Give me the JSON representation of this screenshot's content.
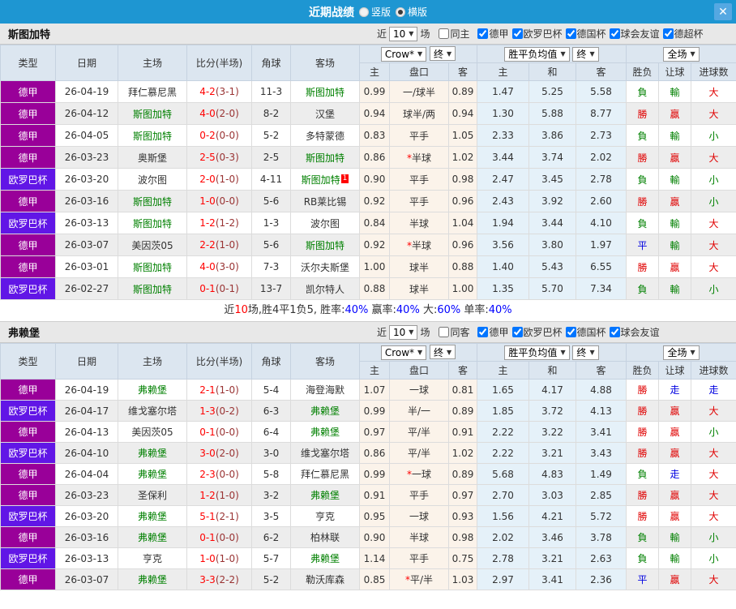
{
  "titlebar": {
    "title": "近期战绩",
    "layout_vertical": "竖版",
    "layout_horizontal": "横版",
    "close": "✕"
  },
  "table_columns": {
    "type": "类型",
    "date": "日期",
    "home": "主场",
    "score": "比分(半场)",
    "corner": "角球",
    "away": "客场",
    "odds_home": "主",
    "handicap": "盘口",
    "odds_away": "客",
    "avg_home": "主",
    "avg_draw": "和",
    "avg_away": "客",
    "result": "胜负",
    "handicap_result": "让球",
    "goals": "进球数"
  },
  "header_controls": {
    "odds_source": "Crow*",
    "final_1": "终",
    "avg_label": "胜平负均值",
    "final_2": "终",
    "scope": "全场"
  },
  "colors": {
    "titlebar": "#1e96d2",
    "close_btn": "#55a8e2",
    "badge_purple": "#990099",
    "badge_violet": "#6116e6",
    "win": "#e00000",
    "lose": "#008000",
    "draw": "#0000e0",
    "team_green": "#008000",
    "score_red": "#ff0000",
    "half_maroon": "#993333",
    "odds_col_bg": "#fbf3ea",
    "avg_col_bg": "#e5f1f9",
    "summary_red": "#ff0000",
    "summary_blue": "#0000ff"
  },
  "sections": [
    {
      "team": "斯图加特",
      "filter": {
        "near_label": "近",
        "count": "10",
        "games_label": "场",
        "same": {
          "label": "同主",
          "checked": false
        },
        "comps": [
          {
            "label": "德甲",
            "checked": true
          },
          {
            "label": "欧罗巴杯",
            "checked": true
          },
          {
            "label": "德国杯",
            "checked": true
          },
          {
            "label": "球会友谊",
            "checked": true
          },
          {
            "label": "德超杯",
            "checked": true
          }
        ]
      },
      "rows": [
        {
          "type": "德甲",
          "date": "26-04-19",
          "home": "拜仁慕尼黑",
          "home_active": false,
          "score": "4-2",
          "half": "(3-1)",
          "corner": "11-3",
          "away": "斯图加特",
          "away_active": true,
          "odds": [
            "0.99",
            "一/球半",
            "0.89"
          ],
          "avg": [
            "1.47",
            "5.25",
            "5.58"
          ],
          "results": [
            "負",
            "輸",
            "大"
          ]
        },
        {
          "type": "德甲",
          "date": "26-04-12",
          "home": "斯图加特",
          "home_active": true,
          "score": "4-0",
          "half": "(2-0)",
          "corner": "8-2",
          "away": "汉堡",
          "away_active": false,
          "odds": [
            "0.94",
            "球半/两",
            "0.94"
          ],
          "avg": [
            "1.30",
            "5.88",
            "8.77"
          ],
          "results": [
            "勝",
            "贏",
            "大"
          ]
        },
        {
          "type": "德甲",
          "date": "26-04-05",
          "home": "斯图加特",
          "home_active": true,
          "score": "0-2",
          "half": "(0-0)",
          "corner": "5-2",
          "away": "多特蒙德",
          "away_active": false,
          "odds": [
            "0.83",
            "平手",
            "1.05"
          ],
          "avg": [
            "2.33",
            "3.86",
            "2.73"
          ],
          "results": [
            "負",
            "輸",
            "小"
          ]
        },
        {
          "type": "德甲",
          "date": "26-03-23",
          "home": "奥斯堡",
          "home_active": false,
          "score": "2-5",
          "half": "(0-3)",
          "corner": "2-5",
          "away": "斯图加特",
          "away_active": true,
          "odds": [
            "0.86",
            "*半球",
            "1.02"
          ],
          "avg": [
            "3.44",
            "3.74",
            "2.02"
          ],
          "results": [
            "勝",
            "贏",
            "大"
          ]
        },
        {
          "type": "欧罗巴杯",
          "date": "26-03-20",
          "home": "波尔图",
          "home_active": false,
          "score": "2-0",
          "half": "(1-0)",
          "corner": "4-11",
          "away": "斯图加特",
          "away_active": true,
          "away_mark": "1",
          "odds": [
            "0.90",
            "平手",
            "0.98"
          ],
          "avg": [
            "2.47",
            "3.45",
            "2.78"
          ],
          "results": [
            "負",
            "輸",
            "小"
          ]
        },
        {
          "type": "德甲",
          "date": "26-03-16",
          "home": "斯图加特",
          "home_active": true,
          "score": "1-0",
          "half": "(0-0)",
          "corner": "5-6",
          "away": "RB莱比锡",
          "away_active": false,
          "odds": [
            "0.92",
            "平手",
            "0.96"
          ],
          "avg": [
            "2.43",
            "3.92",
            "2.60"
          ],
          "results": [
            "勝",
            "贏",
            "小"
          ]
        },
        {
          "type": "欧罗巴杯",
          "date": "26-03-13",
          "home": "斯图加特",
          "home_active": true,
          "score": "1-2",
          "half": "(1-2)",
          "corner": "1-3",
          "away": "波尔图",
          "away_active": false,
          "odds": [
            "0.84",
            "半球",
            "1.04"
          ],
          "avg": [
            "1.94",
            "3.44",
            "4.10"
          ],
          "results": [
            "負",
            "輸",
            "大"
          ]
        },
        {
          "type": "德甲",
          "date": "26-03-07",
          "home": "美因茨05",
          "home_active": false,
          "score": "2-2",
          "half": "(1-0)",
          "corner": "5-6",
          "away": "斯图加特",
          "away_active": true,
          "odds": [
            "0.92",
            "*半球",
            "0.96"
          ],
          "avg": [
            "3.56",
            "3.80",
            "1.97"
          ],
          "results": [
            "平",
            "輸",
            "大"
          ]
        },
        {
          "type": "德甲",
          "date": "26-03-01",
          "home": "斯图加特",
          "home_active": true,
          "score": "4-0",
          "half": "(3-0)",
          "corner": "7-3",
          "away": "沃尔夫斯堡",
          "away_active": false,
          "odds": [
            "1.00",
            "球半",
            "0.88"
          ],
          "avg": [
            "1.40",
            "5.43",
            "6.55"
          ],
          "results": [
            "勝",
            "贏",
            "大"
          ]
        },
        {
          "type": "欧罗巴杯",
          "date": "26-02-27",
          "home": "斯图加特",
          "home_active": true,
          "score": "0-1",
          "half": "(0-1)",
          "corner": "13-7",
          "away": "凯尔特人",
          "away_active": false,
          "odds": [
            "0.88",
            "球半",
            "1.00"
          ],
          "avg": [
            "1.35",
            "5.70",
            "7.34"
          ],
          "results": [
            "負",
            "輸",
            "小"
          ]
        }
      ],
      "summary": [
        {
          "text": "近",
          "color": "default"
        },
        {
          "text": "10",
          "color": "red"
        },
        {
          "text": "场,胜4平1负5, 胜率:",
          "color": "default"
        },
        {
          "text": "40%",
          "color": "blue"
        },
        {
          "text": " 赢率:",
          "color": "default"
        },
        {
          "text": "40%",
          "color": "blue"
        },
        {
          "text": " 大:",
          "color": "default"
        },
        {
          "text": "60%",
          "color": "blue"
        },
        {
          "text": " 单率:",
          "color": "default"
        },
        {
          "text": "40%",
          "color": "blue"
        }
      ]
    },
    {
      "team": "弗赖堡",
      "filter": {
        "near_label": "近",
        "count": "10",
        "games_label": "场",
        "same": {
          "label": "同客",
          "checked": false
        },
        "comps": [
          {
            "label": "德甲",
            "checked": true
          },
          {
            "label": "欧罗巴杯",
            "checked": true
          },
          {
            "label": "德国杯",
            "checked": true
          },
          {
            "label": "球会友谊",
            "checked": true
          }
        ]
      },
      "rows": [
        {
          "type": "德甲",
          "date": "26-04-19",
          "home": "弗赖堡",
          "home_active": true,
          "score": "2-1",
          "half": "(1-0)",
          "corner": "5-4",
          "away": "海登海默",
          "away_active": false,
          "odds": [
            "1.07",
            "一球",
            "0.81"
          ],
          "avg": [
            "1.65",
            "4.17",
            "4.88"
          ],
          "results": [
            "勝",
            "走",
            "走"
          ]
        },
        {
          "type": "欧罗巴杯",
          "date": "26-04-17",
          "home": "维戈塞尔塔",
          "home_active": false,
          "score": "1-3",
          "half": "(0-2)",
          "corner": "6-3",
          "away": "弗赖堡",
          "away_active": true,
          "odds": [
            "0.99",
            "半/一",
            "0.89"
          ],
          "avg": [
            "1.85",
            "3.72",
            "4.13"
          ],
          "results": [
            "勝",
            "贏",
            "大"
          ]
        },
        {
          "type": "德甲",
          "date": "26-04-13",
          "home": "美因茨05",
          "home_active": false,
          "score": "0-1",
          "half": "(0-0)",
          "corner": "6-4",
          "away": "弗赖堡",
          "away_active": true,
          "odds": [
            "0.97",
            "平/半",
            "0.91"
          ],
          "avg": [
            "2.22",
            "3.22",
            "3.41"
          ],
          "results": [
            "勝",
            "贏",
            "小"
          ]
        },
        {
          "type": "欧罗巴杯",
          "date": "26-04-10",
          "home": "弗赖堡",
          "home_active": true,
          "score": "3-0",
          "half": "(2-0)",
          "corner": "3-0",
          "away": "维戈塞尔塔",
          "away_active": false,
          "odds": [
            "0.86",
            "平/半",
            "1.02"
          ],
          "avg": [
            "2.22",
            "3.21",
            "3.43"
          ],
          "results": [
            "勝",
            "贏",
            "大"
          ]
        },
        {
          "type": "德甲",
          "date": "26-04-04",
          "home": "弗赖堡",
          "home_active": true,
          "score": "2-3",
          "half": "(0-0)",
          "corner": "5-8",
          "away": "拜仁慕尼黑",
          "away_active": false,
          "odds": [
            "0.99",
            "*一球",
            "0.89"
          ],
          "avg": [
            "5.68",
            "4.83",
            "1.49"
          ],
          "results": [
            "負",
            "走",
            "大"
          ]
        },
        {
          "type": "德甲",
          "date": "26-03-23",
          "home": "圣保利",
          "home_active": false,
          "score": "1-2",
          "half": "(1-0)",
          "corner": "3-2",
          "away": "弗赖堡",
          "away_active": true,
          "odds": [
            "0.91",
            "平手",
            "0.97"
          ],
          "avg": [
            "2.70",
            "3.03",
            "2.85"
          ],
          "results": [
            "勝",
            "贏",
            "大"
          ]
        },
        {
          "type": "欧罗巴杯",
          "date": "26-03-20",
          "home": "弗赖堡",
          "home_active": true,
          "score": "5-1",
          "half": "(2-1)",
          "corner": "3-5",
          "away": "亨克",
          "away_active": false,
          "odds": [
            "0.95",
            "一球",
            "0.93"
          ],
          "avg": [
            "1.56",
            "4.21",
            "5.72"
          ],
          "results": [
            "勝",
            "贏",
            "大"
          ]
        },
        {
          "type": "德甲",
          "date": "26-03-16",
          "home": "弗赖堡",
          "home_active": true,
          "score": "0-1",
          "half": "(0-0)",
          "corner": "6-2",
          "away": "柏林联",
          "away_active": false,
          "odds": [
            "0.90",
            "半球",
            "0.98"
          ],
          "avg": [
            "2.02",
            "3.46",
            "3.78"
          ],
          "results": [
            "負",
            "輸",
            "小"
          ]
        },
        {
          "type": "欧罗巴杯",
          "date": "26-03-13",
          "home": "亨克",
          "home_active": false,
          "score": "1-0",
          "half": "(1-0)",
          "corner": "5-7",
          "away": "弗赖堡",
          "away_active": true,
          "odds": [
            "1.14",
            "平手",
            "0.75"
          ],
          "avg": [
            "2.78",
            "3.21",
            "2.63"
          ],
          "results": [
            "負",
            "輸",
            "小"
          ]
        },
        {
          "type": "德甲",
          "date": "26-03-07",
          "home": "弗赖堡",
          "home_active": true,
          "score": "3-3",
          "half": "(2-2)",
          "corner": "5-2",
          "away": "勒沃库森",
          "away_active": false,
          "odds": [
            "0.85",
            "*平/半",
            "1.03"
          ],
          "avg": [
            "2.97",
            "3.41",
            "2.36"
          ],
          "results": [
            "平",
            "贏",
            "大"
          ]
        }
      ],
      "summary": null
    }
  ]
}
